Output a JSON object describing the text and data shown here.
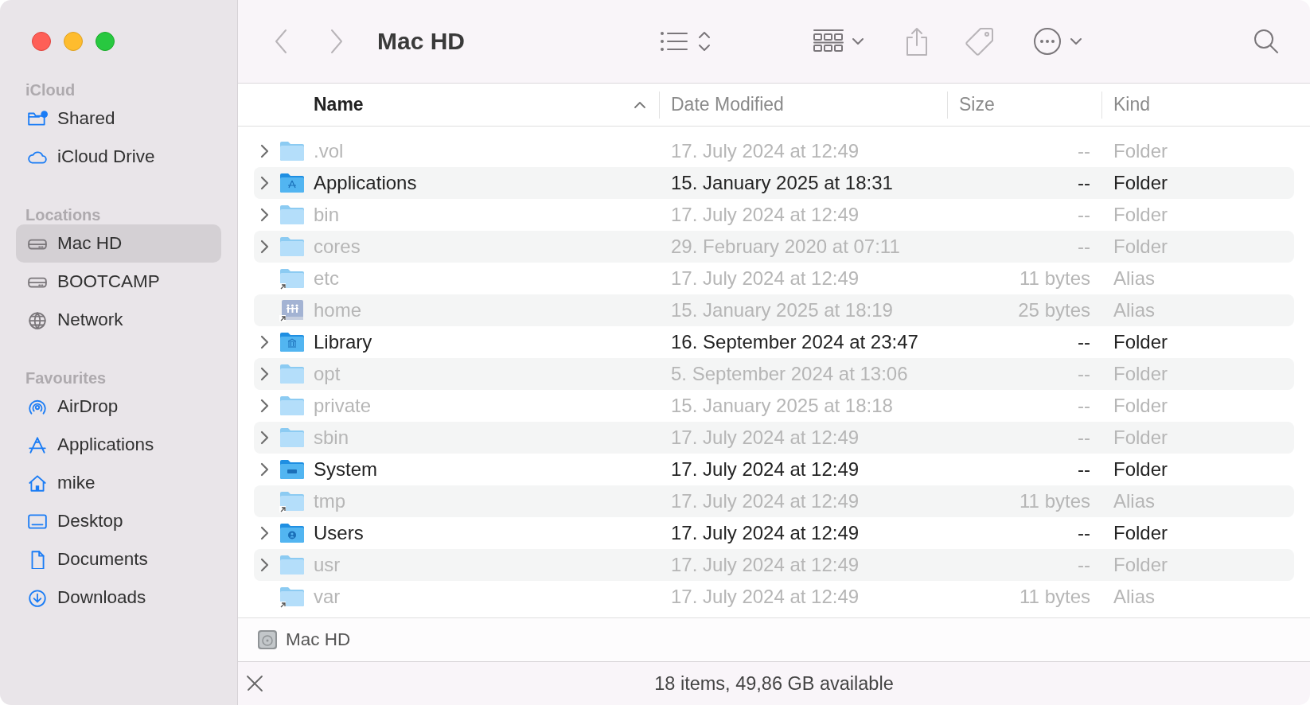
{
  "window": {
    "title": "Mac HD"
  },
  "sidebar": {
    "sections": [
      {
        "title": "iCloud",
        "items": [
          {
            "label": "Shared",
            "kind": "shared",
            "selected": false
          },
          {
            "label": "iCloud Drive",
            "kind": "cloud",
            "selected": false
          }
        ]
      },
      {
        "title": "Locations",
        "items": [
          {
            "label": "Mac HD",
            "kind": "drive",
            "selected": true
          },
          {
            "label": "BOOTCAMP",
            "kind": "drive",
            "selected": false
          },
          {
            "label": "Network",
            "kind": "globe",
            "selected": false
          }
        ]
      },
      {
        "title": "Favourites",
        "items": [
          {
            "label": "AirDrop",
            "kind": "airdrop",
            "selected": false
          },
          {
            "label": "Applications",
            "kind": "apps",
            "selected": false
          },
          {
            "label": "mike",
            "kind": "home",
            "selected": false
          },
          {
            "label": "Desktop",
            "kind": "desktop",
            "selected": false
          },
          {
            "label": "Documents",
            "kind": "document",
            "selected": false
          },
          {
            "label": "Downloads",
            "kind": "download",
            "selected": false
          }
        ]
      }
    ]
  },
  "table": {
    "columns": [
      {
        "label": "Name",
        "sorted": true
      },
      {
        "label": "Date Modified",
        "sorted": false
      },
      {
        "label": "Size",
        "sorted": false
      },
      {
        "label": "Kind",
        "sorted": false
      }
    ],
    "rows": [
      {
        "name": ".vol",
        "date": "17. July 2024 at 12:49",
        "size": "--",
        "file_kind": "Folder",
        "kind": "folder",
        "expandable": true,
        "dimmed": true
      },
      {
        "name": "Applications",
        "date": "15. January 2025 at 18:31",
        "size": "--",
        "file_kind": "Folder",
        "kind": "apps",
        "expandable": true,
        "dimmed": false
      },
      {
        "name": "bin",
        "date": "17. July 2024 at 12:49",
        "size": "--",
        "file_kind": "Folder",
        "kind": "folder",
        "expandable": true,
        "dimmed": true
      },
      {
        "name": "cores",
        "date": "29. February 2020 at 07:11",
        "size": "--",
        "file_kind": "Folder",
        "kind": "folder",
        "expandable": true,
        "dimmed": true
      },
      {
        "name": "etc",
        "date": "17. July 2024 at 12:49",
        "size": "11 bytes",
        "file_kind": "Alias",
        "kind": "alias",
        "expandable": false,
        "dimmed": true
      },
      {
        "name": "home",
        "date": "15. January 2025 at 18:19",
        "size": "25 bytes",
        "file_kind": "Alias",
        "kind": "home",
        "expandable": false,
        "dimmed": true
      },
      {
        "name": "Library",
        "date": "16. September 2024 at 23:47",
        "size": "--",
        "file_kind": "Folder",
        "kind": "library",
        "expandable": true,
        "dimmed": false
      },
      {
        "name": "opt",
        "date": "5. September 2024 at 13:06",
        "size": "--",
        "file_kind": "Folder",
        "kind": "folder",
        "expandable": true,
        "dimmed": true
      },
      {
        "name": "private",
        "date": "15. January 2025 at 18:18",
        "size": "--",
        "file_kind": "Folder",
        "kind": "folder",
        "expandable": true,
        "dimmed": true
      },
      {
        "name": "sbin",
        "date": "17. July 2024 at 12:49",
        "size": "--",
        "file_kind": "Folder",
        "kind": "folder",
        "expandable": true,
        "dimmed": true
      },
      {
        "name": "System",
        "date": "17. July 2024 at 12:49",
        "size": "--",
        "file_kind": "Folder",
        "kind": "system",
        "expandable": true,
        "dimmed": false
      },
      {
        "name": "tmp",
        "date": "17. July 2024 at 12:49",
        "size": "11 bytes",
        "file_kind": "Alias",
        "kind": "alias",
        "expandable": false,
        "dimmed": true
      },
      {
        "name": "Users",
        "date": "17. July 2024 at 12:49",
        "size": "--",
        "file_kind": "Folder",
        "kind": "users",
        "expandable": true,
        "dimmed": false
      },
      {
        "name": "usr",
        "date": "17. July 2024 at 12:49",
        "size": "--",
        "file_kind": "Folder",
        "kind": "folder",
        "expandable": true,
        "dimmed": true
      },
      {
        "name": "var",
        "date": "17. July 2024 at 12:49",
        "size": "11 bytes",
        "file_kind": "Alias",
        "kind": "alias",
        "expandable": false,
        "dimmed": true
      }
    ]
  },
  "path_bar": {
    "label": "Mac HD"
  },
  "status_bar": {
    "text": "18 items, 49,86 GB available"
  }
}
